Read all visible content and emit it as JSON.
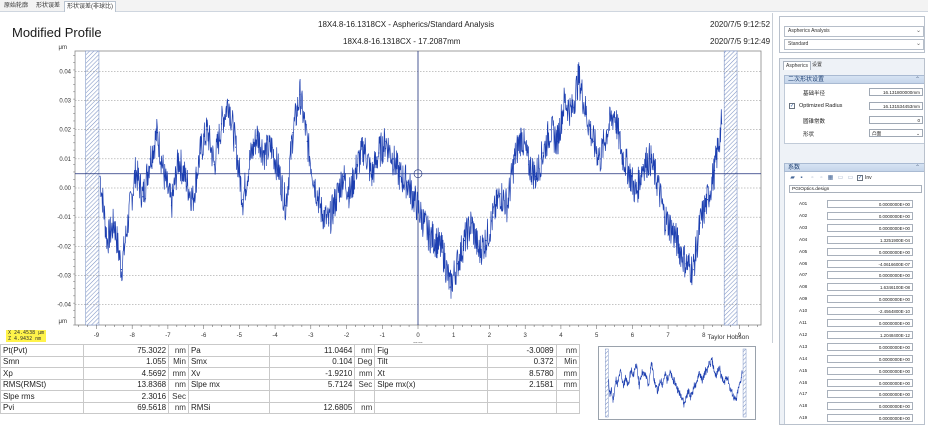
{
  "tabs": [
    {
      "label": "原始轮廓"
    },
    {
      "label": "形状误差"
    },
    {
      "label": "形状误差(非球比)"
    }
  ],
  "chart": {
    "title": "Modified Profile",
    "header_line1": "18X4.8-16.1318CX - Aspherics/Standard Analysis",
    "header_line2": "18X4.8-16.1318CX - 17.2087mm",
    "timestamp1": "2020/7/5 9:12:52",
    "timestamp2": "2020/7/5 9:12:49",
    "y_unit_top": "μm",
    "y_unit_bottom": "μm",
    "x_unit": "mm",
    "brand": "Taylor Hobson",
    "cursor_x": "X  24.4538 μm",
    "cursor_z": "Z   4.9432 nm"
  },
  "chart_data": {
    "type": "line",
    "xlabel": "mm",
    "ylabel": "μm",
    "xlim": [
      -9.6,
      9.6
    ],
    "ylim": [
      -0.047,
      0.047
    ],
    "x_ticks": [
      -9,
      -8,
      -7,
      -6,
      -5,
      -4,
      -3,
      -2,
      -1,
      0,
      1,
      2,
      3,
      4,
      5,
      6,
      7,
      8,
      9
    ],
    "y_ticks": [
      -0.04,
      -0.03,
      -0.02,
      -0.01,
      0.0,
      0.01,
      0.02,
      0.03,
      0.04
    ],
    "y_tick_labels": [
      "-0.04",
      "-0.03",
      "-0.02",
      "-0.01",
      "0.00",
      "0.01",
      "0.02",
      "0.03",
      "0.04"
    ],
    "excluded_regions": [
      [
        -9.3,
        -8.93
      ],
      [
        8.57,
        8.93
      ]
    ],
    "series": [
      {
        "color": "#1d3fb0",
        "x": [
          -8.9,
          -8.7,
          -8.5,
          -8.3,
          -8.1,
          -7.9,
          -7.7,
          -7.5,
          -7.3,
          -7.1,
          -6.9,
          -6.7,
          -6.5,
          -6.3,
          -6.1,
          -5.9,
          -5.7,
          -5.5,
          -5.3,
          -5.1,
          -4.9,
          -4.7,
          -4.5,
          -4.3,
          -4.1,
          -3.9,
          -3.7,
          -3.5,
          -3.3,
          -3.1,
          -2.9,
          -2.7,
          -2.5,
          -2.3,
          -2.1,
          -1.9,
          -1.7,
          -1.5,
          -1.3,
          -1.1,
          -0.9,
          -0.7,
          -0.5,
          -0.3,
          -0.1,
          0.1,
          0.3,
          0.5,
          0.7,
          0.9,
          1.1,
          1.3,
          1.5,
          1.7,
          1.9,
          2.1,
          2.3,
          2.5,
          2.7,
          2.9,
          3.1,
          3.3,
          3.5,
          3.7,
          3.9,
          4.1,
          4.3,
          4.5,
          4.7,
          4.9,
          5.1,
          5.3,
          5.5,
          5.7,
          5.9,
          6.1,
          6.3,
          6.5,
          6.7,
          6.9,
          7.1,
          7.3,
          7.5,
          7.7,
          7.9,
          8.1,
          8.3,
          8.5
        ],
        "y": [
          0.004,
          -0.018,
          -0.012,
          -0.028,
          -0.01,
          0.006,
          -0.003,
          0.01,
          0.019,
          0.004,
          -0.006,
          0.01,
          0.003,
          -0.004,
          0.012,
          0.02,
          0.008,
          0.022,
          0.03,
          0.014,
          -0.004,
          0.01,
          0.018,
          0.012,
          0.014,
          0.006,
          -0.006,
          0.019,
          0.032,
          0.016,
          0.002,
          -0.008,
          -0.012,
          -0.004,
          0.004,
          -0.002,
          0.008,
          0.014,
          0.004,
          0.012,
          0.016,
          0.01,
          0.004,
          0.002,
          -0.004,
          -0.01,
          -0.016,
          -0.018,
          -0.022,
          -0.034,
          -0.026,
          -0.018,
          -0.012,
          -0.022,
          -0.018,
          -0.01,
          -0.002,
          -0.006,
          0.01,
          0.018,
          0.008,
          0.004,
          0.012,
          0.02,
          0.016,
          0.03,
          0.026,
          0.038,
          0.026,
          0.016,
          0.01,
          0.02,
          0.026,
          0.012,
          0.006,
          -0.002,
          0.008,
          0.01,
          0.002,
          -0.01,
          -0.014,
          -0.02,
          -0.026,
          -0.028,
          -0.012,
          -0.004,
          0.006,
          0.022
        ]
      }
    ]
  },
  "params": [
    [
      {
        "label": "Pt(Pvt)",
        "value": "75.3022",
        "unit": "nm"
      },
      {
        "label": "Pa",
        "value": "11.0464",
        "unit": "nm"
      },
      {
        "label": "Fig",
        "value": "-3.0089",
        "unit": "nm"
      }
    ],
    [
      {
        "label": "Smn",
        "value": "1.055",
        "unit": "Min"
      },
      {
        "label": "Smx",
        "value": "0.104",
        "unit": "Deg"
      },
      {
        "label": "Tilt",
        "value": "0.372",
        "unit": "Min"
      }
    ],
    [
      {
        "label": "Xp",
        "value": "4.5692",
        "unit": "mm"
      },
      {
        "label": "Xv",
        "value": "-1.9210",
        "unit": "mm"
      },
      {
        "label": "Xt",
        "value": "8.5780",
        "unit": "mm"
      }
    ],
    [
      {
        "label": "RMS(RMSt)",
        "value": "13.8368",
        "unit": "nm"
      },
      {
        "label": "Slpe mx",
        "value": "5.7124",
        "unit": "Sec"
      },
      {
        "label": "Slpe mx(x)",
        "value": "2.1581",
        "unit": "mm"
      }
    ],
    [
      {
        "label": "Slpe rms",
        "value": "2.3016",
        "unit": "Sec"
      },
      {
        "label": "",
        "value": "",
        "unit": ""
      },
      {
        "label": "",
        "value": "",
        "unit": ""
      }
    ],
    [
      {
        "label": "Pvi",
        "value": "69.5618",
        "unit": "nm"
      },
      {
        "label": "RMSi",
        "value": "12.6805",
        "unit": "nm"
      },
      {
        "label": "",
        "value": "",
        "unit": ""
      }
    ]
  ],
  "right_top": {
    "analysis_select": "Aspherics Analysis",
    "standard_select": "Standard"
  },
  "right_main": {
    "subtabs": [
      {
        "label": "Aspherics"
      },
      {
        "label": "设置"
      }
    ],
    "section1_title": "二次形状设置",
    "base_radius_label": "基础半径",
    "base_radius_value": "16.131800000mm",
    "optimized_radius_label": "Optimized Radius",
    "optimized_radius_value": "16.131534453mm",
    "conic_label": "圆锥常数",
    "conic_value": "0",
    "shape_label": "形状",
    "shape_value": "凸面",
    "section2_title": "系数",
    "inv_label": "Inv",
    "design_name": "PGIOptics.design",
    "coefficients": [
      {
        "name": "A01",
        "value": "0.0000000E+00"
      },
      {
        "name": "A02",
        "value": "0.0000000E+00"
      },
      {
        "name": "A03",
        "value": "0.0000000E+00"
      },
      {
        "name": "A04",
        "value": "1.3251900E-04"
      },
      {
        "name": "A05",
        "value": "0.0000000E+00"
      },
      {
        "name": "A06",
        "value": "-4.0616600E-07"
      },
      {
        "name": "A07",
        "value": "0.0000000E+00"
      },
      {
        "name": "A08",
        "value": "1.6346100E-08"
      },
      {
        "name": "A09",
        "value": "0.0000000E+00"
      },
      {
        "name": "A10",
        "value": "-2.4564800E-10"
      },
      {
        "name": "A11",
        "value": "0.0000000E+00"
      },
      {
        "name": "A12",
        "value": "1.2048400E-12"
      },
      {
        "name": "A13",
        "value": "0.0000000E+00"
      },
      {
        "name": "A14",
        "value": "0.0000000E+00"
      },
      {
        "name": "A15",
        "value": "0.0000000E+00"
      },
      {
        "name": "A16",
        "value": "0.0000000E+00"
      },
      {
        "name": "A17",
        "value": "0.0000000E+00"
      },
      {
        "name": "A18",
        "value": "0.0000000E+00"
      },
      {
        "name": "A19",
        "value": "0.0000000E+00"
      }
    ]
  }
}
